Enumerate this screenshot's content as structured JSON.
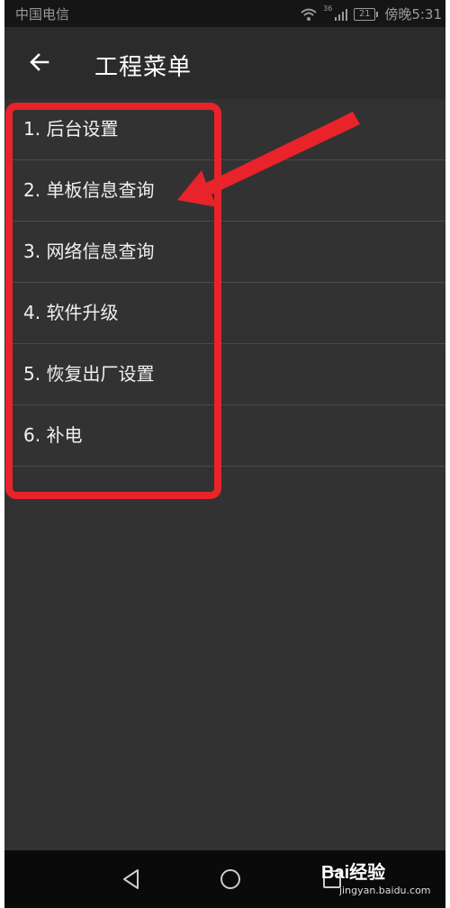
{
  "status_bar": {
    "carrier": "中国电信",
    "battery": "21",
    "time": "傍晚5:31",
    "network_type": "36",
    "icons": [
      "wifi-icon",
      "signal-icon",
      "battery-icon"
    ]
  },
  "app_bar": {
    "title": "工程菜单",
    "back_icon": "arrow-left-icon"
  },
  "menu": {
    "items": [
      {
        "label": "1. 后台设置"
      },
      {
        "label": "2. 单板信息查询"
      },
      {
        "label": "3. 网络信息查询"
      },
      {
        "label": "4. 软件升级"
      },
      {
        "label": "5. 恢复出厂设置"
      },
      {
        "label": "6. 补电"
      }
    ]
  },
  "nav_bar": {
    "icons": [
      "back-triangle-icon",
      "home-circle-icon",
      "recents-square-icon"
    ]
  },
  "watermark": {
    "logo": "Bai经验",
    "url": "jingyan.baidu.com"
  },
  "colors": {
    "background": "#323232",
    "app_bar": "#2b2b2b",
    "status_bar": "#151515",
    "nav_bar": "#0a0a0a",
    "annotation": "#e8232a",
    "text": "#f0f0f0"
  }
}
